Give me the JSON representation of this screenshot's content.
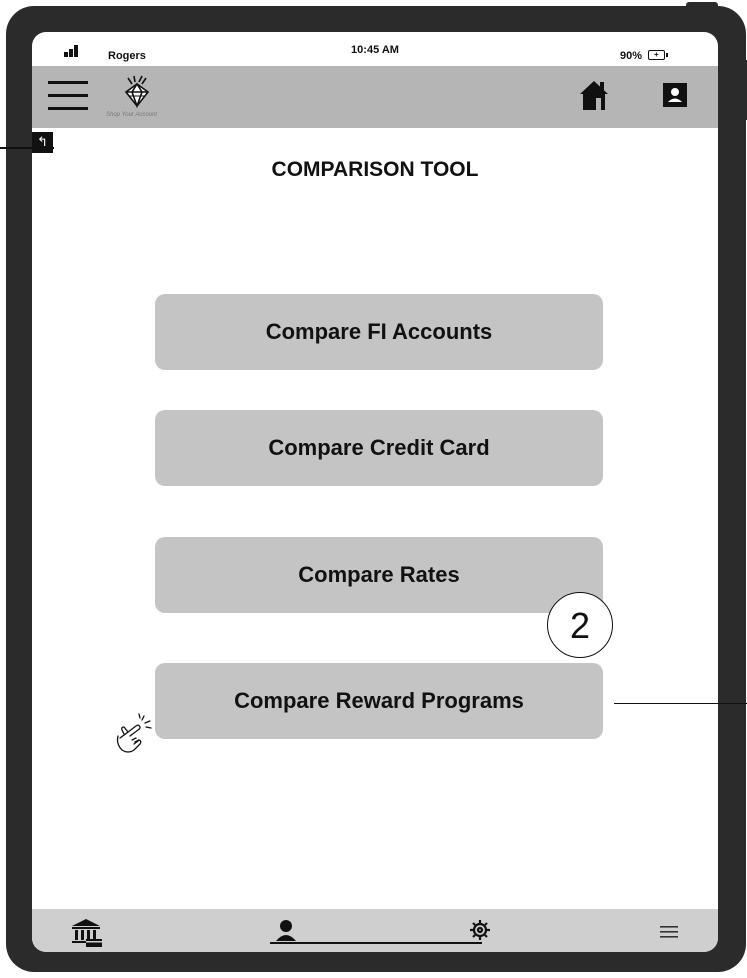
{
  "status_bar": {
    "carrier": "Rogers",
    "time": "10:45 AM",
    "battery_percent": "90%"
  },
  "header": {
    "logo_caption": "Shop Your Account",
    "icons": [
      "menu-icon",
      "diamond-logo-icon",
      "home-icon",
      "profile-icon"
    ]
  },
  "page": {
    "title": "COMPARISON TOOL",
    "back_icon": "back-arrow-icon"
  },
  "buttons": [
    {
      "label": "Compare FI Accounts"
    },
    {
      "label": "Compare Credit Card"
    },
    {
      "label": "Compare Rates"
    },
    {
      "label": "Compare Reward Programs"
    }
  ],
  "annotation": {
    "callout_number": "2",
    "pointer_icon": "tap-hand-icon"
  },
  "bottom_nav": {
    "items": [
      "bank-icon",
      "user-icon",
      "settings-icon",
      "menu-icon"
    ]
  },
  "colors": {
    "device_frame": "#2b2b2b",
    "header_bg": "#b5b5b5",
    "button_bg": "#c4c4c4",
    "bottom_bar_bg": "#cfcfcf"
  }
}
